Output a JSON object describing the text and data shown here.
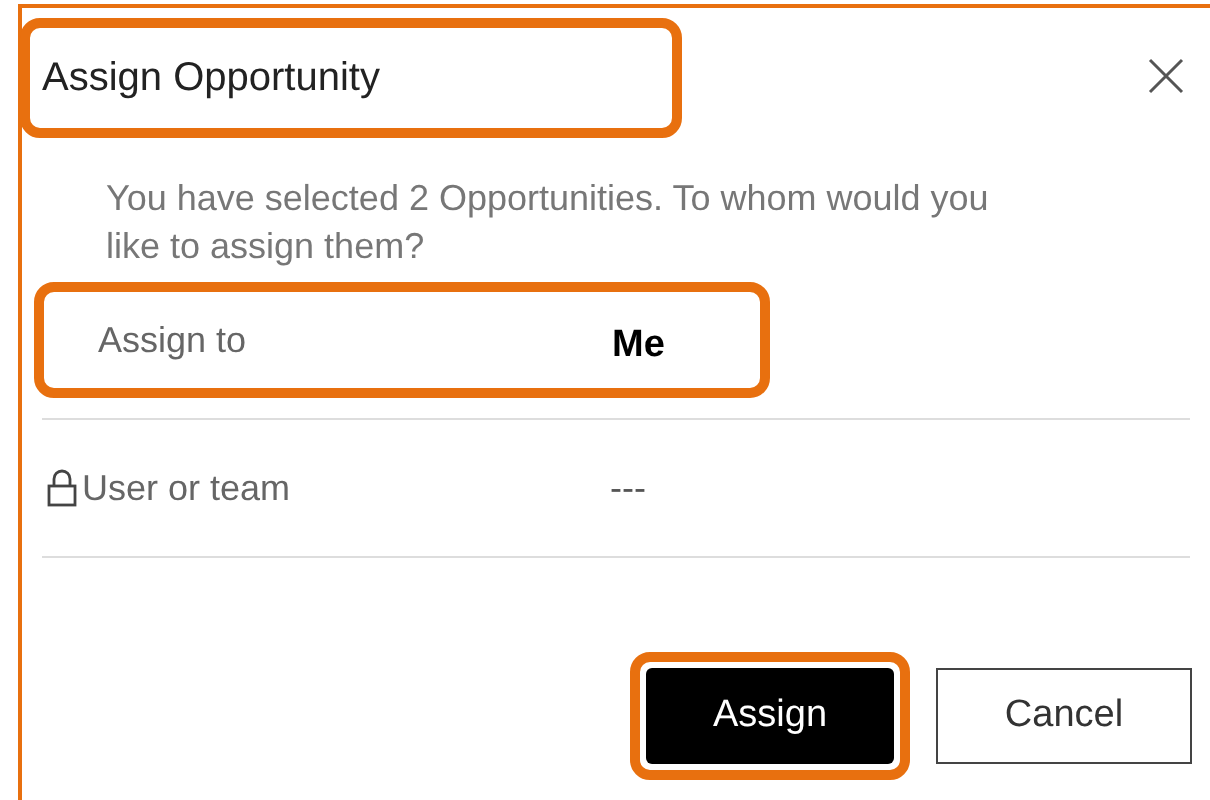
{
  "dialog": {
    "title": "Assign Opportunity",
    "title_highlighted": true,
    "message": "You have selected 2 Opportunities. To whom would you like to assign them?"
  },
  "fields": [
    {
      "label": "Assign to",
      "value": "Me",
      "locked": false,
      "highlighted": true,
      "kind": "choice"
    },
    {
      "label": "User or team",
      "value": "---",
      "locked": true,
      "highlighted": false,
      "kind": "lookup"
    }
  ],
  "buttons": [
    {
      "label": "Assign",
      "kind": "primary",
      "highlighted": true
    },
    {
      "label": "Cancel",
      "kind": "secondary",
      "highlighted": false
    }
  ]
}
